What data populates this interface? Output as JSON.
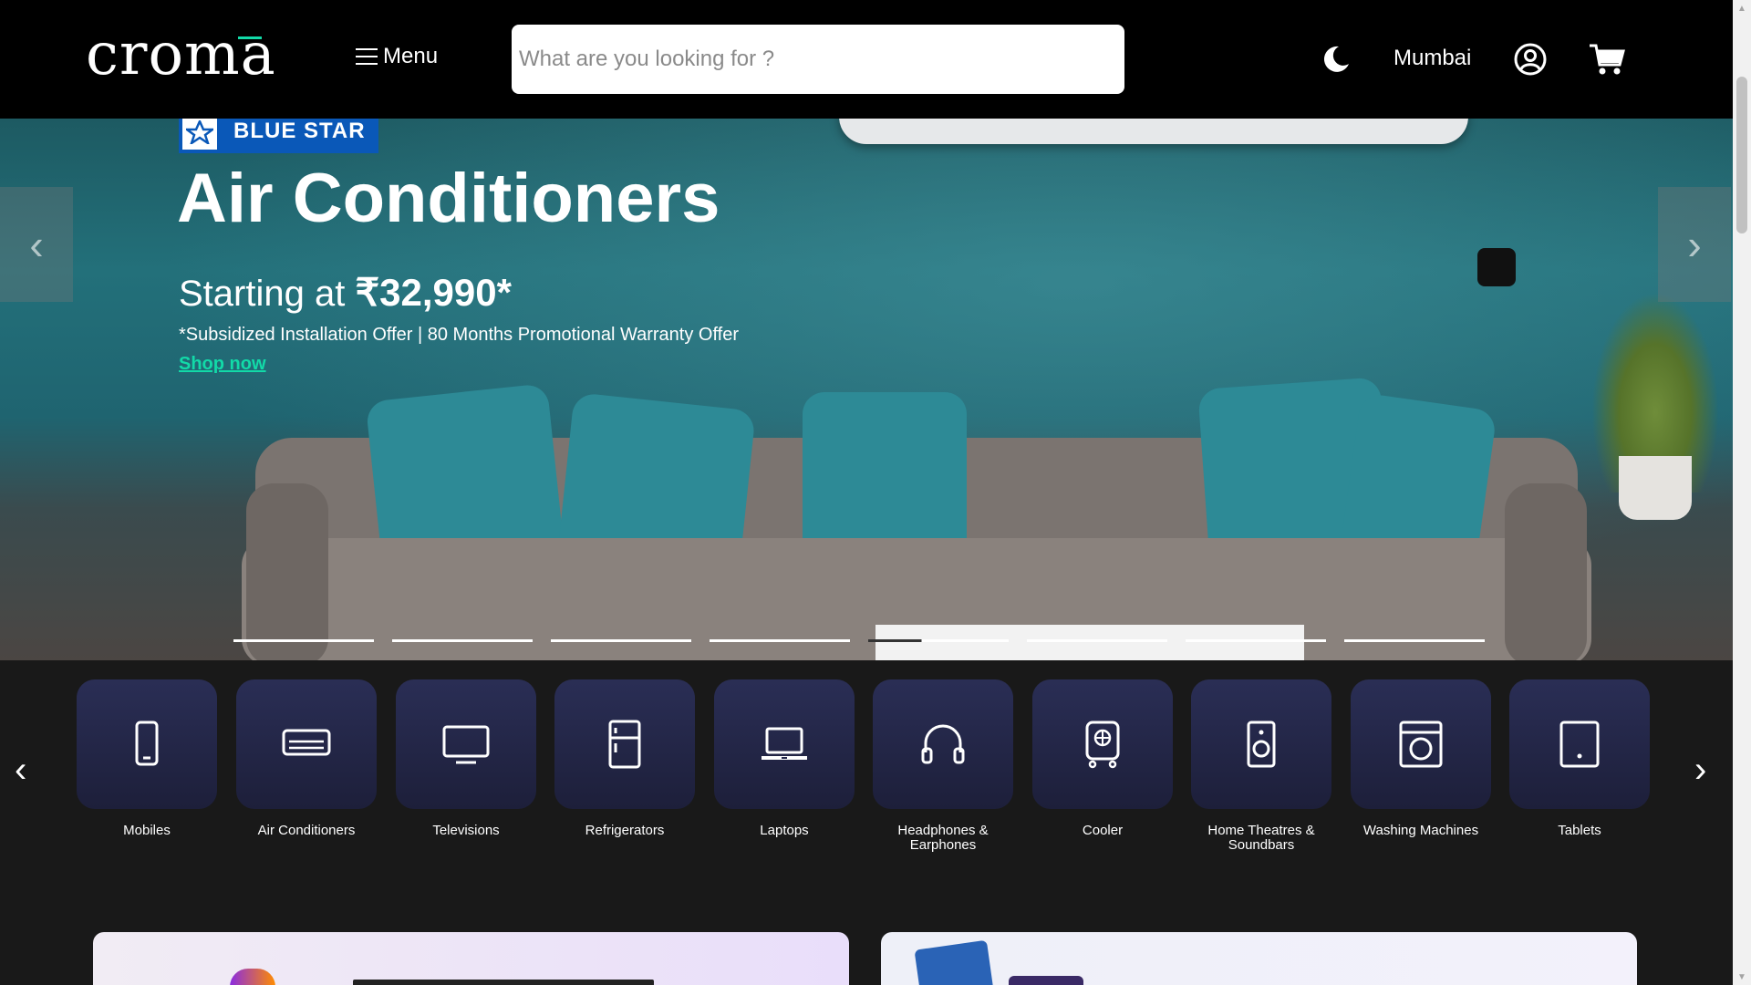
{
  "header": {
    "logo": "croma",
    "menu_label": "Menu",
    "search_placeholder": "What are you looking for ?",
    "city": "Mumbai",
    "icons": [
      "moon-icon",
      "user-circle-icon",
      "cart-icon"
    ]
  },
  "hero": {
    "brand": "BLUE STAR",
    "title": "Air Conditioners",
    "subtitle_prefix": "Starting at ",
    "price": "₹32,990*",
    "note": "*Subsidized Installation Offer | 80 Months Promotional Warranty Offer",
    "cta": "Shop now",
    "prev_arrow": "‹",
    "next_arrow": "›",
    "slide_count": 8,
    "active_slide": 4
  },
  "categories": {
    "prev_arrow": "‹",
    "next_arrow": "›",
    "items": [
      {
        "label": "Mobiles",
        "icon": "mobile-icon"
      },
      {
        "label": "Air Conditioners",
        "icon": "air-conditioner-icon"
      },
      {
        "label": "Televisions",
        "icon": "television-icon"
      },
      {
        "label": "Refrigerators",
        "icon": "refrigerator-icon"
      },
      {
        "label": "Laptops",
        "icon": "laptop-icon"
      },
      {
        "label": "Headphones & Earphones",
        "icon": "headphones-icon"
      },
      {
        "label": "Cooler",
        "icon": "cooler-icon"
      },
      {
        "label": "Home Theatres & Soundbars",
        "icon": "speaker-icon"
      },
      {
        "label": "Washing Machines",
        "icon": "washing-machine-icon"
      },
      {
        "label": "Tablets",
        "icon": "tablet-icon"
      }
    ]
  },
  "colors": {
    "accent": "#12daa8",
    "header_bg": "#000000",
    "page_bg": "#191919",
    "tile_bg": "#23264a",
    "brand_blue": "#0a58b8"
  }
}
